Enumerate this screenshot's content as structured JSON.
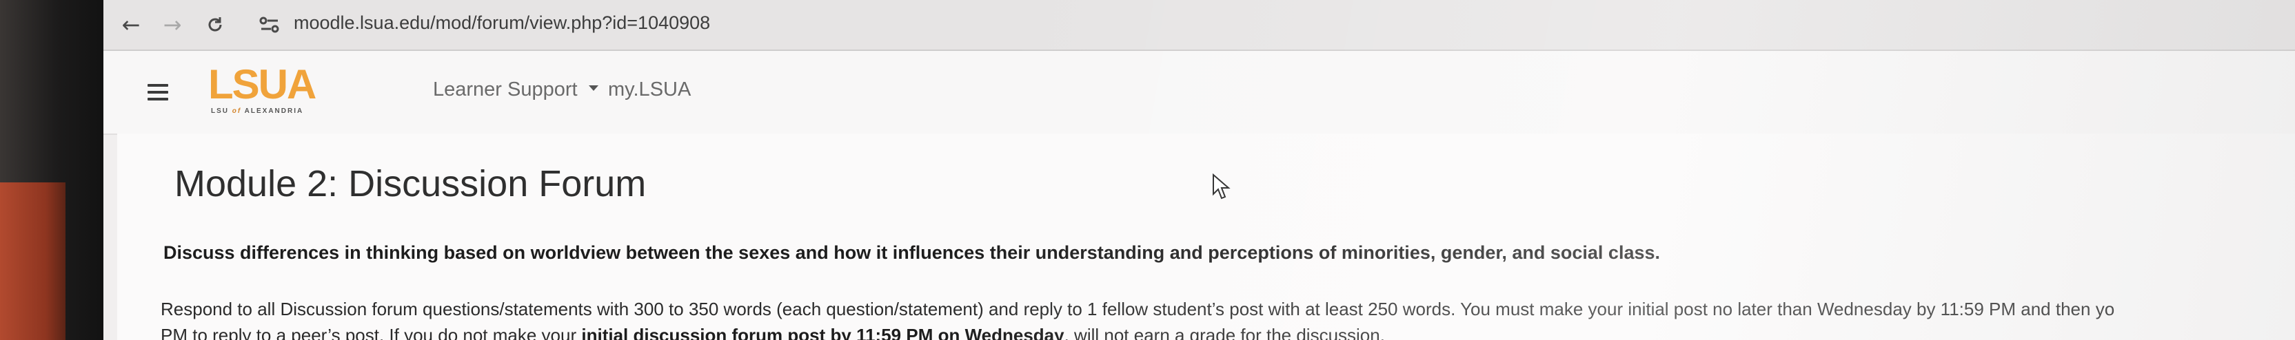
{
  "browser": {
    "url": "moodle.lsua.edu/mod/forum/view.php?id=1040908"
  },
  "header": {
    "logo_text": "LSUA",
    "logo_sub_1": "LSU",
    "logo_sub_of": "of",
    "logo_sub_2": "ALEXANDRIA",
    "menu": [
      {
        "label": "Learner Support"
      },
      {
        "label": "my.LSUA"
      }
    ]
  },
  "main": {
    "title": "Module 2: Discussion Forum",
    "prompt": "Discuss differences in thinking based on worldview between the sexes and how it influences their understanding and perceptions of minorities, gender, and social class.",
    "para_line1": "Respond to all Discussion forum questions/statements with 300 to 350 words (each question/statement) and reply to 1 fellow student’s post with at least 250 words. You must make your initial post no later than Wednesday by 11:59 PM and then yo",
    "para_line2_a": "PM to reply to a peer’s post. If you do not make your ",
    "para_line2_bold": "initial discussion forum post by 11:59 PM on Wednesday",
    "para_line2_b": ", will not earn a grade for the discussion."
  }
}
